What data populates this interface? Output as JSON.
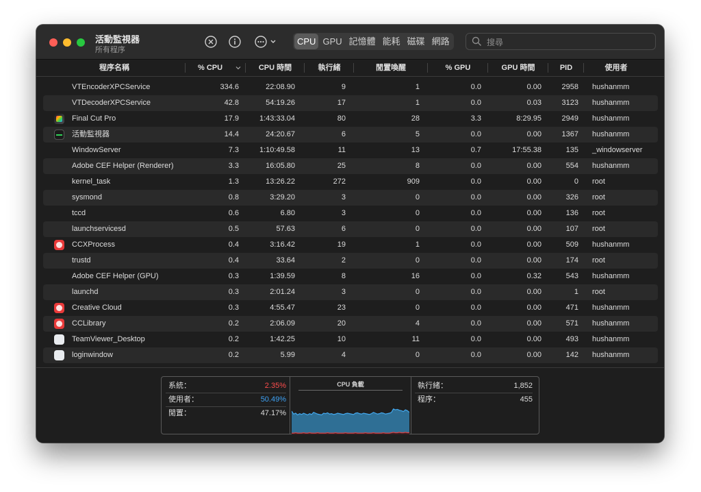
{
  "window": {
    "title": "活動監視器",
    "subtitle": "所有程序"
  },
  "toolbar": {
    "tabs": [
      "CPU",
      "GPU",
      "記憶體",
      "能耗",
      "磁碟",
      "網路"
    ],
    "active_tab": "CPU",
    "search_placeholder": "搜尋"
  },
  "columns": [
    "程序名稱",
    "% CPU",
    "CPU 時間",
    "執行緒",
    "閒置喚醒",
    "% GPU",
    "GPU 時間",
    "PID",
    "使用者"
  ],
  "rows": [
    {
      "name": "VTEncoderXPCService",
      "cpu": "334.6",
      "cpu_time": "22:08.90",
      "threads": "9",
      "idle_wake": "1",
      "gpu": "0.0",
      "gpu_time": "0.00",
      "pid": "2958",
      "user": "hushanmm",
      "icon": "none"
    },
    {
      "name": "VTDecoderXPCService",
      "cpu": "42.8",
      "cpu_time": "54:19.26",
      "threads": "17",
      "idle_wake": "1",
      "gpu": "0.0",
      "gpu_time": "0.03",
      "pid": "3123",
      "user": "hushanmm",
      "icon": "none"
    },
    {
      "name": "Final Cut Pro",
      "cpu": "17.9",
      "cpu_time": "1:43:33.04",
      "threads": "80",
      "idle_wake": "28",
      "gpu": "3.3",
      "gpu_time": "8:29.95",
      "pid": "2949",
      "user": "hushanmm",
      "icon": "final-cut-pro"
    },
    {
      "name": "活動監視器",
      "cpu": "14.4",
      "cpu_time": "24:20.67",
      "threads": "6",
      "idle_wake": "5",
      "gpu": "0.0",
      "gpu_time": "0.00",
      "pid": "1367",
      "user": "hushanmm",
      "icon": "activity-monitor"
    },
    {
      "name": "WindowServer",
      "cpu": "7.3",
      "cpu_time": "1:10:49.58",
      "threads": "11",
      "idle_wake": "13",
      "gpu": "0.7",
      "gpu_time": "17:55.38",
      "pid": "135",
      "user": "_windowserver",
      "icon": "none"
    },
    {
      "name": "Adobe CEF Helper (Renderer)",
      "cpu": "3.3",
      "cpu_time": "16:05.80",
      "threads": "25",
      "idle_wake": "8",
      "gpu": "0.0",
      "gpu_time": "0.00",
      "pid": "554",
      "user": "hushanmm",
      "icon": "none"
    },
    {
      "name": "kernel_task",
      "cpu": "1.3",
      "cpu_time": "13:26.22",
      "threads": "272",
      "idle_wake": "909",
      "gpu": "0.0",
      "gpu_time": "0.00",
      "pid": "0",
      "user": "root",
      "icon": "none"
    },
    {
      "name": "sysmond",
      "cpu": "0.8",
      "cpu_time": "3:29.20",
      "threads": "3",
      "idle_wake": "0",
      "gpu": "0.0",
      "gpu_time": "0.00",
      "pid": "326",
      "user": "root",
      "icon": "none"
    },
    {
      "name": "tccd",
      "cpu": "0.6",
      "cpu_time": "6.80",
      "threads": "3",
      "idle_wake": "0",
      "gpu": "0.0",
      "gpu_time": "0.00",
      "pid": "136",
      "user": "root",
      "icon": "none"
    },
    {
      "name": "launchservicesd",
      "cpu": "0.5",
      "cpu_time": "57.63",
      "threads": "6",
      "idle_wake": "0",
      "gpu": "0.0",
      "gpu_time": "0.00",
      "pid": "107",
      "user": "root",
      "icon": "none"
    },
    {
      "name": "CCXProcess",
      "cpu": "0.4",
      "cpu_time": "3:16.42",
      "threads": "19",
      "idle_wake": "1",
      "gpu": "0.0",
      "gpu_time": "0.00",
      "pid": "509",
      "user": "hushanmm",
      "icon": "creative-cloud"
    },
    {
      "name": "trustd",
      "cpu": "0.4",
      "cpu_time": "33.64",
      "threads": "2",
      "idle_wake": "0",
      "gpu": "0.0",
      "gpu_time": "0.00",
      "pid": "174",
      "user": "root",
      "icon": "none"
    },
    {
      "name": "Adobe CEF Helper (GPU)",
      "cpu": "0.3",
      "cpu_time": "1:39.59",
      "threads": "8",
      "idle_wake": "16",
      "gpu": "0.0",
      "gpu_time": "0.32",
      "pid": "543",
      "user": "hushanmm",
      "icon": "none"
    },
    {
      "name": "launchd",
      "cpu": "0.3",
      "cpu_time": "2:01.24",
      "threads": "3",
      "idle_wake": "0",
      "gpu": "0.0",
      "gpu_time": "0.00",
      "pid": "1",
      "user": "root",
      "icon": "none"
    },
    {
      "name": "Creative Cloud",
      "cpu": "0.3",
      "cpu_time": "4:55.47",
      "threads": "23",
      "idle_wake": "0",
      "gpu": "0.0",
      "gpu_time": "0.00",
      "pid": "471",
      "user": "hushanmm",
      "icon": "creative-cloud"
    },
    {
      "name": "CCLibrary",
      "cpu": "0.2",
      "cpu_time": "2:06.09",
      "threads": "20",
      "idle_wake": "4",
      "gpu": "0.0",
      "gpu_time": "0.00",
      "pid": "571",
      "user": "hushanmm",
      "icon": "creative-cloud"
    },
    {
      "name": "TeamViewer_Desktop",
      "cpu": "0.2",
      "cpu_time": "1:42.25",
      "threads": "10",
      "idle_wake": "11",
      "gpu": "0.0",
      "gpu_time": "0.00",
      "pid": "493",
      "user": "hushanmm",
      "icon": "generic-app"
    },
    {
      "name": "loginwindow",
      "cpu": "0.2",
      "cpu_time": "5.99",
      "threads": "4",
      "idle_wake": "0",
      "gpu": "0.0",
      "gpu_time": "0.00",
      "pid": "142",
      "user": "hushanmm",
      "icon": "generic-app"
    }
  ],
  "footer": {
    "system_label": "系統：",
    "system_value": "2.35%",
    "user_label": "使用者：",
    "user_value": "50.49%",
    "idle_label": "閒置：",
    "idle_value": "47.17%",
    "chart_title": "CPU 負載",
    "threads_label": "執行緒：",
    "threads_value": "1,852",
    "processes_label": "程序：",
    "processes_value": "455"
  },
  "colors": {
    "system": "#ff4d4d",
    "user": "#3ea2f5",
    "chart_user_fill": "#2f6f95",
    "chart_user_line": "#43a8ee",
    "chart_system": "#d94040"
  },
  "chart_data": {
    "type": "area",
    "title": "CPU 負載",
    "series": [
      {
        "name": "使用者",
        "values": [
          55,
          48,
          50,
          46,
          49,
          47,
          50,
          48,
          46,
          49,
          47,
          52,
          50,
          48,
          47,
          46,
          50,
          49,
          51,
          48,
          49,
          47,
          48,
          50,
          49,
          48,
          47,
          49,
          50,
          49,
          48,
          47,
          50,
          51,
          49,
          48,
          50,
          49,
          48,
          47,
          49,
          52,
          50,
          48,
          49,
          51,
          50,
          48,
          49,
          50,
          52,
          60,
          58,
          59,
          57,
          56,
          54,
          58,
          56,
          52
        ]
      },
      {
        "name": "系統",
        "values": [
          3,
          3,
          4,
          3,
          3,
          3,
          4,
          3,
          3,
          4,
          3,
          3,
          3,
          4,
          3,
          3,
          3,
          3,
          4,
          3,
          3,
          3,
          4,
          3,
          3,
          3,
          3,
          4,
          3,
          3,
          3,
          3,
          4,
          3,
          3,
          3,
          3,
          4,
          3,
          3,
          3,
          4,
          3,
          3,
          3,
          3,
          4,
          3,
          3,
          3,
          4,
          5,
          4,
          4,
          5,
          4,
          4,
          5,
          4,
          4
        ]
      }
    ],
    "ylim": [
      0,
      100
    ]
  }
}
